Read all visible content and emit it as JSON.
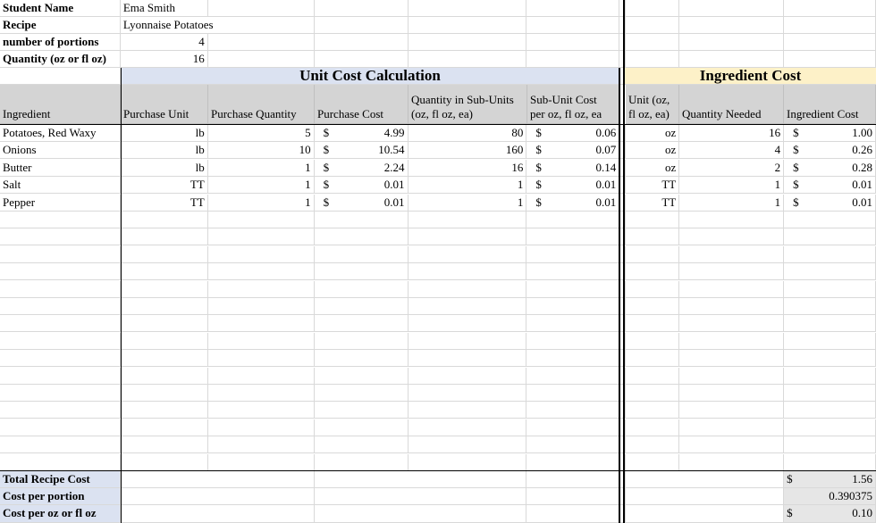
{
  "info": {
    "student_name_label": "Student Name",
    "student_name": "Ema Smith",
    "recipe_label": "Recipe",
    "recipe": "Lyonnaise Potatoes",
    "portions_label": "number of portions",
    "portions": "4",
    "quantity_label": "Quantity (oz or fl oz)",
    "quantity": "16"
  },
  "sections": {
    "unit_cost": "Unit Cost Calculation",
    "ingredient_cost": "Ingredient Cost"
  },
  "headers": {
    "ingredient": "Ingredient",
    "purchase_unit": "Purchase Unit",
    "purchase_quantity": "Purchase Quantity",
    "purchase_cost": "Purchase Cost",
    "qty_sub_line1": "Quantity in Sub-Units",
    "qty_sub_line2": "(oz, fl oz, ea)",
    "sub_cost_line1": "Sub-Unit Cost",
    "sub_cost_line2": "per oz, fl oz, ea",
    "unit_line1": "Unit (oz,",
    "unit_line2": "fl oz, ea)",
    "quantity_needed": "Quantity Needed",
    "ingredient_cost": "Ingredient Cost"
  },
  "rows": [
    {
      "ingredient": "Potatoes, Red Waxy",
      "purchase_unit": "lb",
      "purchase_qty": "5",
      "cur1": "$",
      "purchase_cost": "4.99",
      "qty_sub": "80",
      "cur2": "$",
      "sub_cost": "0.06",
      "unit": "oz",
      "qty_needed": "16",
      "cur3": "$",
      "ing_cost": "1.00"
    },
    {
      "ingredient": "Onions",
      "purchase_unit": "lb",
      "purchase_qty": "10",
      "cur1": "$",
      "purchase_cost": "10.54",
      "qty_sub": "160",
      "cur2": "$",
      "sub_cost": "0.07",
      "unit": "oz",
      "qty_needed": "4",
      "cur3": "$",
      "ing_cost": "0.26"
    },
    {
      "ingredient": "Butter",
      "purchase_unit": "lb",
      "purchase_qty": "1",
      "cur1": "$",
      "purchase_cost": "2.24",
      "qty_sub": "16",
      "cur2": "$",
      "sub_cost": "0.14",
      "unit": "oz",
      "qty_needed": "2",
      "cur3": "$",
      "ing_cost": "0.28"
    },
    {
      "ingredient": "Salt",
      "purchase_unit": "TT",
      "purchase_qty": "1",
      "cur1": "$",
      "purchase_cost": "0.01",
      "qty_sub": "1",
      "cur2": "$",
      "sub_cost": "0.01",
      "unit": "TT",
      "qty_needed": "1",
      "cur3": "$",
      "ing_cost": "0.01"
    },
    {
      "ingredient": "Pepper",
      "purchase_unit": "TT",
      "purchase_qty": "1",
      "cur1": "$",
      "purchase_cost": "0.01",
      "qty_sub": "1",
      "cur2": "$",
      "sub_cost": "0.01",
      "unit": "TT",
      "qty_needed": "1",
      "cur3": "$",
      "ing_cost": "0.01"
    }
  ],
  "totals": {
    "total_label": "Total Recipe Cost",
    "total_cur": "$",
    "total_value": "1.56",
    "portion_label": "Cost per portion",
    "portion_value": "0.390375",
    "oz_label": "Cost per oz or fl oz",
    "oz_cur": "$",
    "oz_value": "0.10"
  }
}
